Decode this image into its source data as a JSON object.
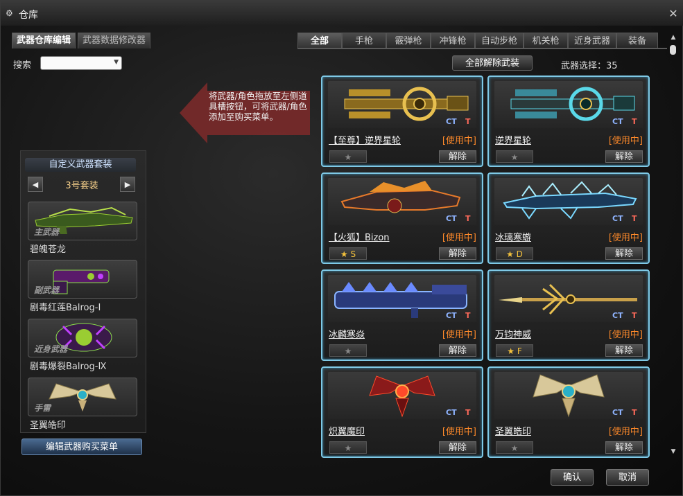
{
  "window": {
    "title": "仓库"
  },
  "left_tabs": [
    {
      "label": "武器仓库编辑",
      "active": true
    },
    {
      "label": "武器数据修改器",
      "active": false
    }
  ],
  "search": {
    "label": "搜索",
    "value": ""
  },
  "hint": {
    "text": "将武器/角色拖放至左侧道具槽按钮，可将武器/角色添加至购买菜单。"
  },
  "custom_set": {
    "title": "自定义武器套装",
    "current": "3号套装",
    "slots": [
      {
        "category": "主武器",
        "name": "碧魄苍龙",
        "icon": "green-dragon-rifle"
      },
      {
        "category": "副武器",
        "name": "剧毒红莲Balrog-Ⅰ",
        "icon": "venom-pistol"
      },
      {
        "category": "近身武器",
        "name": "剧毒爆裂Balrog-Ⅸ",
        "icon": "venom-gauntlet"
      },
      {
        "category": "手雷",
        "name": "圣翼皓印",
        "icon": "winged-emblem"
      }
    ],
    "edit_button": "编辑武器购买菜单"
  },
  "category_tabs": [
    "全部",
    "手枪",
    "霰弹枪",
    "冲锋枪",
    "自动步枪",
    "机关枪",
    "近身武器",
    "装备"
  ],
  "active_category": "全部",
  "unequip_all": "全部解除武装",
  "weapon_count": {
    "label": "武器选择：",
    "value": "35"
  },
  "team_labels": {
    "ct": "CT",
    "t": "T"
  },
  "status_label": "[使用中]",
  "unequip_label": "解除",
  "weapons": [
    {
      "name": "【至尊】逆界星轮",
      "rating": "★",
      "art": "gold-star-wheel"
    },
    {
      "name": "逆界星轮",
      "rating": "★",
      "art": "cyan-star-wheel"
    },
    {
      "name": "【火狐】Bizon",
      "rating": "★ S",
      "art": "fire-fox-bizon"
    },
    {
      "name": "冰璃寒蝣",
      "rating": "★ D",
      "art": "ice-crystal-rifle"
    },
    {
      "name": "冰麟寒焱",
      "rating": "★",
      "art": "ice-qilin-cannon"
    },
    {
      "name": "万钧神威",
      "rating": "★ F",
      "art": "golden-spear"
    },
    {
      "name": "炽翼魔印",
      "rating": "★",
      "art": "crimson-wing-emblem"
    },
    {
      "name": "圣翼皓印",
      "rating": "★",
      "art": "holy-wing-emblem"
    }
  ],
  "buttons": {
    "ok": "确认",
    "cancel": "取消"
  },
  "colors": {
    "card_border": "#7fc9e6",
    "in_use": "#ff8a2a",
    "star": "#f5c23c",
    "ct": "#8fb4ff",
    "t": "#ff6a5a"
  }
}
